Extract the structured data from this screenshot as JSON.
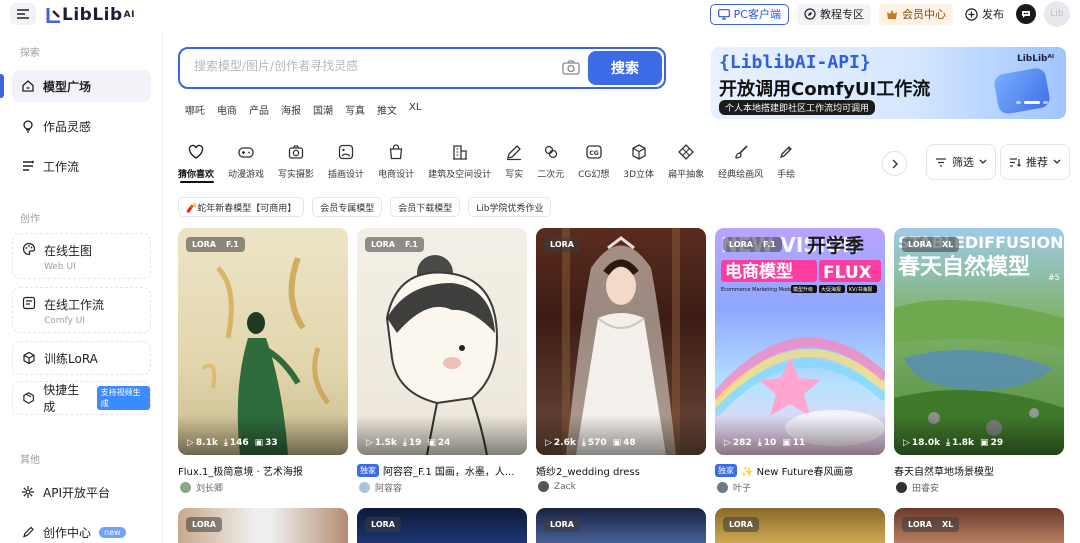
{
  "header": {
    "logo_text": "LibLib",
    "logo_suffix": "AI",
    "pc_client": "PC客户端",
    "tutorials": "教程专区",
    "vip_center": "会员中心",
    "publish": "发布",
    "avatar_text": "Lib"
  },
  "sidebar": {
    "section_explore": "探索",
    "section_create": "创作",
    "section_other": "其他",
    "items": [
      {
        "label": "模型广场"
      },
      {
        "label": "作品灵感"
      },
      {
        "label": "工作流"
      },
      {
        "label": "在线生图",
        "sub": "Web UI"
      },
      {
        "label": "在线工作流",
        "sub": "Comfy UI"
      },
      {
        "label": "训练LoRA"
      },
      {
        "label": "快捷生成",
        "badge": "支持视频生成"
      },
      {
        "label": "API开放平台"
      },
      {
        "label": "创作中心",
        "badge": "new"
      }
    ]
  },
  "search": {
    "placeholder": "搜索模型/图片/创作者寻找灵感",
    "button": "搜索",
    "hot_tags": [
      "哪吒",
      "电商",
      "产品",
      "海报",
      "国潮",
      "写真",
      "推文",
      "XL"
    ]
  },
  "banner": {
    "title": "{LiblibAI-API}",
    "subtitle": "开放调用ComfyUI工作流",
    "caption": "个人本地搭建即社区工作流均可调用",
    "logo": "LibLibᴬᴵ"
  },
  "categories": [
    {
      "label": "猜你喜欢",
      "icon": "heart-icon"
    },
    {
      "label": "动漫游戏",
      "icon": "gamepad-icon"
    },
    {
      "label": "写实摄影",
      "icon": "camera-icon"
    },
    {
      "label": "插画设计",
      "icon": "image-icon"
    },
    {
      "label": "电商设计",
      "icon": "shopping-bag-icon"
    },
    {
      "label": "建筑及空间设计",
      "icon": "building-icon"
    },
    {
      "label": "写实",
      "icon": "pen-icon"
    },
    {
      "label": "二次元",
      "icon": "flower-icon"
    },
    {
      "label": "CG幻想",
      "icon": "cg-icon"
    },
    {
      "label": "3D立体",
      "icon": "cube-icon"
    },
    {
      "label": "扁平抽象",
      "icon": "diamond-icon"
    },
    {
      "label": "经典绘画风",
      "icon": "brush-icon"
    },
    {
      "label": "手绘",
      "icon": "pencil-icon"
    }
  ],
  "filters": {
    "filter": "筛选",
    "sort": "推荐"
  },
  "subtags": [
    "🧨蛇年新春模型【可商用】",
    "会员专属模型",
    "会员下载模型",
    "Lib学院优秀作业"
  ],
  "cards": [
    {
      "tags": [
        "LORA",
        "F.1"
      ],
      "stats": [
        "8.1k",
        "146",
        "33"
      ],
      "title": "Flux.1_极简意境 · 艺术海报",
      "exclusive": "",
      "author": "刘长卿"
    },
    {
      "tags": [
        "LORA",
        "F.1"
      ],
      "stats": [
        "1.5k",
        "19",
        "24"
      ],
      "title": "阿容容_F.1 国画，水墨，人...",
      "exclusive": "独家",
      "author": "阿容容"
    },
    {
      "tags": [
        "LORA"
      ],
      "stats": [
        "2.6k",
        "570",
        "48"
      ],
      "title": "婚纱2_wedding dress",
      "exclusive": "",
      "author": "Zack"
    },
    {
      "tags": [
        "LORA",
        "F.1"
      ],
      "stats": [
        "282",
        "10",
        "11"
      ],
      "title": "✨ New Future春风画意",
      "exclusive": "独家",
      "author": "叶子"
    },
    {
      "tags": [
        "LORA",
        "XL"
      ],
      "stats": [
        "18.0k",
        "1.8k",
        "29"
      ],
      "title": "春天自然草地场景模型",
      "exclusive": "",
      "author": "田睿安"
    }
  ],
  "card_overlay_text": {
    "c4_top": "NEW VISION",
    "c4_top2": "开学季",
    "c4_main": "电商模型",
    "c4_flux": "FLUX",
    "c4_en": "Ecommerce Marketing Model",
    "c4_chips": [
      "模型升级",
      "大促海报",
      "KV/书海报"
    ],
    "c5_top": "STABLEDIFFUSION",
    "c5_main": "春天自然模型",
    "c5_num": "#5"
  },
  "second_row": [
    {
      "tags": [
        "LORA"
      ]
    },
    {
      "tags": [
        "LORA"
      ]
    },
    {
      "tags": [
        "LORA"
      ]
    },
    {
      "tags": [
        "LORA"
      ]
    },
    {
      "tags": [
        "LORA",
        "XL"
      ]
    }
  ]
}
